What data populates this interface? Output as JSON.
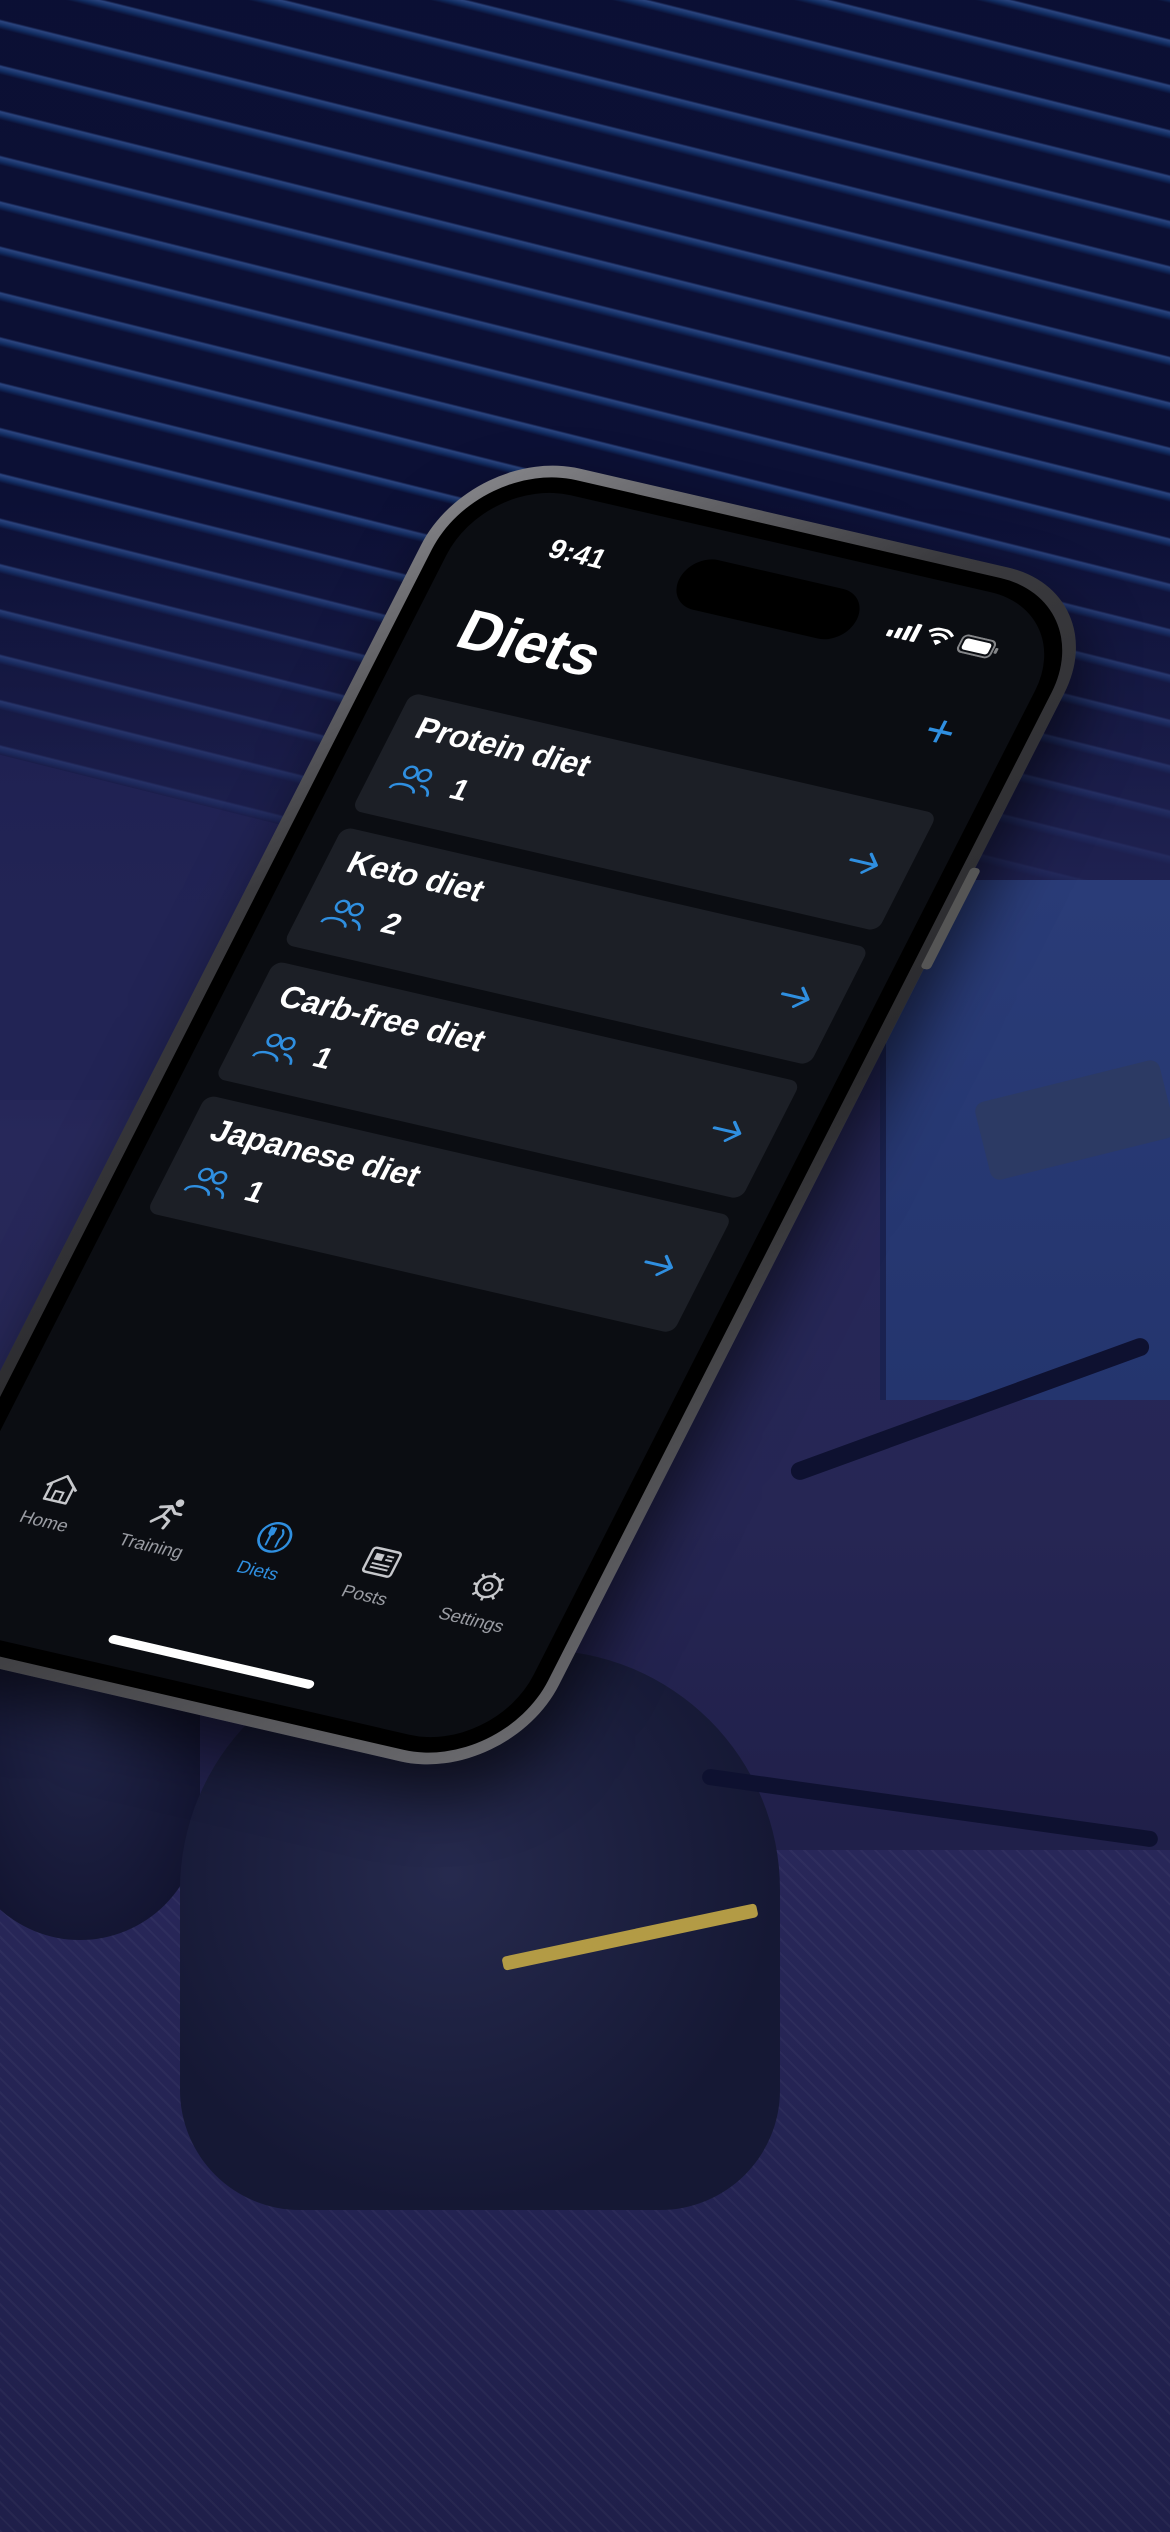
{
  "status_bar": {
    "time": "9:41"
  },
  "header": {
    "title": "Diets",
    "add_label": "+"
  },
  "diets": [
    {
      "name": "Protein diet",
      "members": "1"
    },
    {
      "name": "Keto diet",
      "members": "2"
    },
    {
      "name": "Carb-free diet",
      "members": "1"
    },
    {
      "name": "Japanese diet",
      "members": "1"
    }
  ],
  "tab_bar": {
    "tabs": [
      {
        "label": "Home",
        "icon": "home-icon"
      },
      {
        "label": "Training",
        "icon": "runner-icon"
      },
      {
        "label": "Diets",
        "icon": "utensils-icon",
        "active": true
      },
      {
        "label": "Posts",
        "icon": "newspaper-icon"
      },
      {
        "label": "Settings",
        "icon": "gear-icon"
      }
    ]
  },
  "colors": {
    "accent": "#2f8fe0",
    "screen_bg": "#0b0d12",
    "card_bg": "#1c1f26",
    "inactive_tab": "#9a9ca3"
  }
}
